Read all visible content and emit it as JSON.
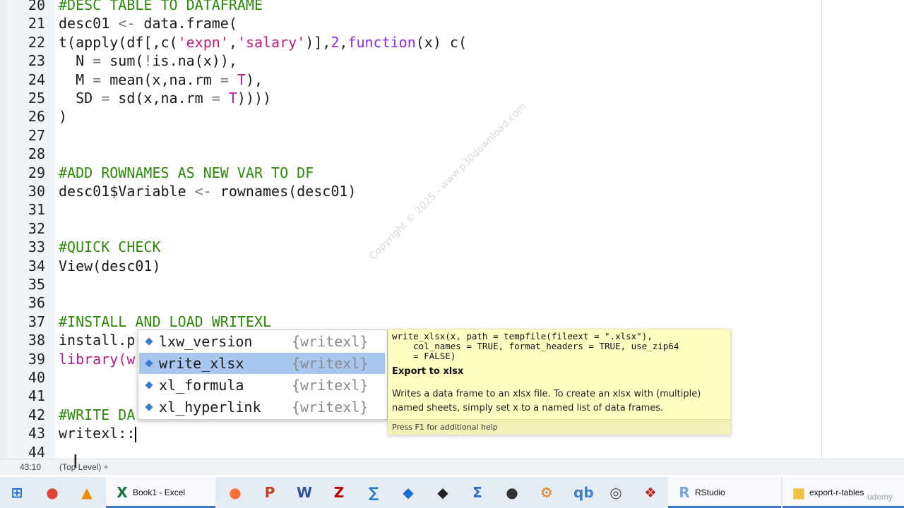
{
  "editor": {
    "lines": [
      {
        "n": "20",
        "parts": [
          {
            "t": "#DESC TABLE TO DATAFRAME",
            "c": "cm"
          }
        ]
      },
      {
        "n": "21",
        "parts": [
          {
            "t": "desc01 "
          },
          {
            "t": "<-",
            "c": "op"
          },
          {
            "t": " data.frame("
          }
        ]
      },
      {
        "n": "22",
        "parts": [
          {
            "t": "t(apply(df[,c("
          },
          {
            "t": "'expn'",
            "c": "st"
          },
          {
            "t": ","
          },
          {
            "t": "'salary'",
            "c": "st"
          },
          {
            "t": ")],"
          },
          {
            "t": "2",
            "c": "num"
          },
          {
            "t": ","
          },
          {
            "t": "function",
            "c": "kw"
          },
          {
            "t": "(x) c("
          }
        ]
      },
      {
        "n": "23",
        "parts": [
          {
            "t": "  N "
          },
          {
            "t": "=",
            "c": "op"
          },
          {
            "t": " sum("
          },
          {
            "t": "!",
            "c": "op"
          },
          {
            "t": "is.na(x)),"
          }
        ]
      },
      {
        "n": "24",
        "parts": [
          {
            "t": "  M "
          },
          {
            "t": "=",
            "c": "op"
          },
          {
            "t": " mean(x,na.rm "
          },
          {
            "t": "=",
            "c": "op"
          },
          {
            "t": " "
          },
          {
            "t": "T",
            "c": "mg"
          },
          {
            "t": "),"
          }
        ]
      },
      {
        "n": "25",
        "parts": [
          {
            "t": "  SD "
          },
          {
            "t": "=",
            "c": "op"
          },
          {
            "t": " sd(x,na.rm "
          },
          {
            "t": "=",
            "c": "op"
          },
          {
            "t": " "
          },
          {
            "t": "T",
            "c": "mg"
          },
          {
            "t": "))))"
          }
        ]
      },
      {
        "n": "26",
        "parts": [
          {
            "t": ")"
          }
        ]
      },
      {
        "n": "27",
        "parts": []
      },
      {
        "n": "28",
        "parts": []
      },
      {
        "n": "29",
        "parts": [
          {
            "t": "#ADD ROWNAMES AS NEW VAR TO DF",
            "c": "cm"
          }
        ]
      },
      {
        "n": "30",
        "parts": [
          {
            "t": "desc01$Variable "
          },
          {
            "t": "<-",
            "c": "op"
          },
          {
            "t": " rownames(desc01)"
          }
        ]
      },
      {
        "n": "31",
        "parts": []
      },
      {
        "n": "32",
        "parts": []
      },
      {
        "n": "33",
        "parts": [
          {
            "t": "#QUICK CHECK",
            "c": "cm"
          }
        ]
      },
      {
        "n": "34",
        "parts": [
          {
            "t": "View(desc01)"
          }
        ]
      },
      {
        "n": "35",
        "parts": []
      },
      {
        "n": "36",
        "parts": []
      },
      {
        "n": "37",
        "parts": [
          {
            "t": "#INSTALL AND LOAD WRITEXL",
            "c": "cm"
          }
        ]
      },
      {
        "n": "38",
        "parts": [
          {
            "t": "install.p"
          }
        ]
      },
      {
        "n": "39",
        "parts": [
          {
            "t": "library(w",
            "c": "mg"
          }
        ]
      },
      {
        "n": "40",
        "parts": []
      },
      {
        "n": "41",
        "parts": []
      },
      {
        "n": "42",
        "parts": [
          {
            "t": "#WRITE DA",
            "c": "cm"
          }
        ]
      },
      {
        "n": "43",
        "parts": [
          {
            "t": "writexl::"
          }
        ],
        "cursor": true
      },
      {
        "n": "44",
        "parts": []
      }
    ],
    "watermark": "Copyright © 2025 - www.p30download.com"
  },
  "autocomplete": {
    "items": [
      {
        "name": "lxw_version",
        "pkg": "{writexl}",
        "selected": false
      },
      {
        "name": "write_xlsx",
        "pkg": "{writexl}",
        "selected": true
      },
      {
        "name": "xl_formula",
        "pkg": "{writexl}",
        "selected": false
      },
      {
        "name": "xl_hyperlink",
        "pkg": "{writexl}",
        "selected": false
      }
    ]
  },
  "help": {
    "signature": "write_xlsx(x, path = tempfile(fileext = \".xlsx\"),\n    col_names = TRUE, format_headers = TRUE, use_zip64\n    = FALSE)",
    "title": "Export to xlsx",
    "description": "Writes a data frame to an xlsx file. To create an xlsx with (multiple) named sheets, simply set x to a named list of data frames.",
    "f1_hint": "Press F1 for additional help"
  },
  "statusbar": {
    "position": "43:10",
    "scope": "(Top Level) ÷"
  },
  "taskbar": {
    "items": [
      {
        "name": "start-button",
        "icon": "windows-icon",
        "label": "",
        "color": "#1f6fd1"
      },
      {
        "name": "chrome-button",
        "icon": "chrome-icon",
        "label": "",
        "color": "#db4437"
      },
      {
        "name": "vlc-button",
        "icon": "vlc-icon",
        "label": "",
        "color": "#f08a00"
      },
      {
        "name": "excel-button",
        "icon": "excel-icon",
        "label": "Book1 - Excel",
        "color": "#1d7244"
      },
      {
        "name": "firefox-button",
        "icon": "firefox-icon",
        "label": "",
        "color": "#ff7139"
      },
      {
        "name": "powerpoint-button",
        "icon": "powerpoint-icon",
        "label": "",
        "color": "#c43e1c"
      },
      {
        "name": "word-button",
        "icon": "word-icon",
        "label": "",
        "color": "#2b579a"
      },
      {
        "name": "filezilla-button",
        "icon": "filezilla-icon",
        "label": "",
        "color": "#bf0000"
      },
      {
        "name": "app-button-1",
        "icon": "math-icon",
        "label": "",
        "color": "#2a7bd3"
      },
      {
        "name": "app-button-2",
        "icon": "shield-icon",
        "label": "",
        "color": "#1a6ed8"
      },
      {
        "name": "app-button-3",
        "icon": "inkscape-icon",
        "label": "",
        "color": "#222222"
      },
      {
        "name": "app-button-4",
        "icon": "sigma-icon",
        "label": "",
        "color": "#2a6fce"
      },
      {
        "name": "app-button-5",
        "icon": "obs-icon",
        "label": "",
        "color": "#333333"
      },
      {
        "name": "app-button-6",
        "icon": "tool-icon",
        "label": "",
        "color": "#e07b1c"
      },
      {
        "name": "app-button-7",
        "icon": "qb-icon",
        "label": "",
        "color": "#3b82c4"
      },
      {
        "name": "app-button-8",
        "icon": "globe-icon",
        "label": "",
        "color": "#4a4a4a"
      },
      {
        "name": "app-button-9",
        "icon": "puzzle-icon",
        "label": "",
        "color": "#c0281f"
      },
      {
        "name": "rstudio-button",
        "icon": "rstudio-icon",
        "label": "RStudio",
        "color": "#75aadb"
      },
      {
        "name": "folder-button",
        "icon": "folder-icon",
        "label": "export-r-tables",
        "color": "#f2c144"
      }
    ],
    "udemy": "udemy"
  }
}
